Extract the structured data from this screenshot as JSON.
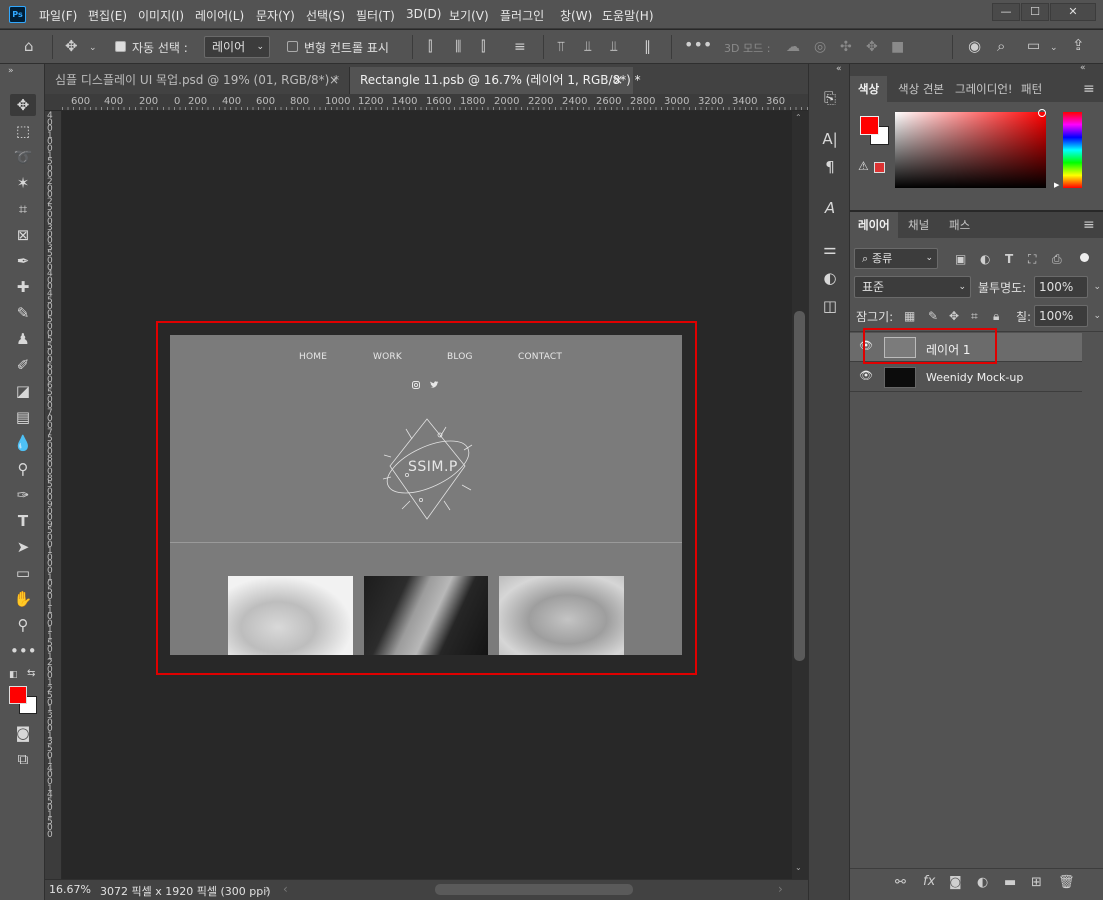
{
  "menu": {
    "logo": "Ps",
    "items": [
      "파일(F)",
      "편집(E)",
      "이미지(I)",
      "레이어(L)",
      "문자(Y)",
      "선택(S)",
      "필터(T)",
      "3D(D)",
      "보기(V)",
      "플러그인",
      "창(W)",
      "도움말(H)"
    ]
  },
  "window_controls": {
    "minimize": "—",
    "maximize": "☐",
    "close": "✕"
  },
  "options": {
    "auto_select_label": "자동 선택 :",
    "auto_select_value": "레이어",
    "transform_label": "변형 컨트롤 표시",
    "mode_3d": "3D 모드 :"
  },
  "tabs": [
    {
      "label": "심플 디스플레이 UI 목업.psd @ 19% (01, RGB/8*) *",
      "close": "×"
    },
    {
      "label": "Rectangle 11.psb @ 16.7% (레이어 1, RGB/8*) *",
      "close": "×"
    }
  ],
  "ruler": {
    "h": [
      "600",
      "400",
      "200",
      "0",
      "200",
      "400",
      "600",
      "800",
      "1000",
      "1200",
      "1400",
      "1600",
      "1800",
      "2000",
      "2200",
      "2400",
      "2600",
      "2800",
      "3000",
      "3200",
      "3400",
      "360"
    ],
    "v": [
      "4",
      "0",
      "0",
      "1",
      "0",
      "0",
      "1",
      "5",
      "0",
      "0",
      "2",
      "0",
      "0",
      "2",
      "5",
      "0",
      "0",
      "3",
      "0",
      "0",
      "3",
      "5",
      "0",
      "0",
      "4",
      "0",
      "0",
      "4",
      "5",
      "0",
      "0",
      "5",
      "0",
      "0",
      "5",
      "5",
      "0",
      "0",
      "6",
      "0",
      "0",
      "6",
      "5",
      "0",
      "0",
      "7",
      "0",
      "0",
      "7",
      "5",
      "0",
      "0",
      "8",
      "0",
      "0",
      "8",
      "5",
      "0",
      "0",
      "9",
      "0",
      "0",
      "9",
      "5",
      "0",
      "0",
      "1",
      "0",
      "0",
      "0",
      "1",
      "0",
      "5",
      "0",
      "1",
      "1",
      "0",
      "0",
      "1",
      "1",
      "5",
      "0",
      "1",
      "2",
      "0",
      "0",
      "1",
      "2",
      "5",
      "0",
      "1",
      "3",
      "0",
      "0",
      "1",
      "3",
      "5",
      "0",
      "1",
      "4",
      "0",
      "0",
      "1",
      "4",
      "5",
      "0",
      "1",
      "5",
      "0",
      "0"
    ]
  },
  "document": {
    "nav": [
      "HOME",
      "WORK",
      "BLOG",
      "CONTACT"
    ],
    "logo_text": "SSIM.P",
    "social_icons": [
      "instagram-icon",
      "twitter-icon"
    ]
  },
  "status": {
    "zoom": "16.67%",
    "info": "3072 픽셀 x 1920 픽셀 (300 ppi)",
    "arrow": "›"
  },
  "color_panel": {
    "tabs": [
      "색상",
      "색상 견본",
      "그레이디언!",
      "패턴"
    ],
    "foreground": "#ff0000",
    "background": "#ffffff"
  },
  "layer_panel": {
    "tabs": [
      "레이어",
      "채널",
      "패스"
    ],
    "filter_label": "종류",
    "blend_mode": "표준",
    "opacity_label": "불투명도:",
    "opacity_value": "100%",
    "lock_label": "잠그기:",
    "fill_label": "칠:",
    "fill_value": "100%",
    "layers": [
      {
        "name": "레이어 1",
        "selected": true
      },
      {
        "name": "Weenidy Mock-up",
        "selected": false
      }
    ],
    "footer_icons": [
      "link-icon",
      "fx-icon",
      "mask-icon",
      "adjustment-icon",
      "folder-icon",
      "new-layer-icon",
      "trash-icon"
    ]
  },
  "annotation_color": "#e00000"
}
